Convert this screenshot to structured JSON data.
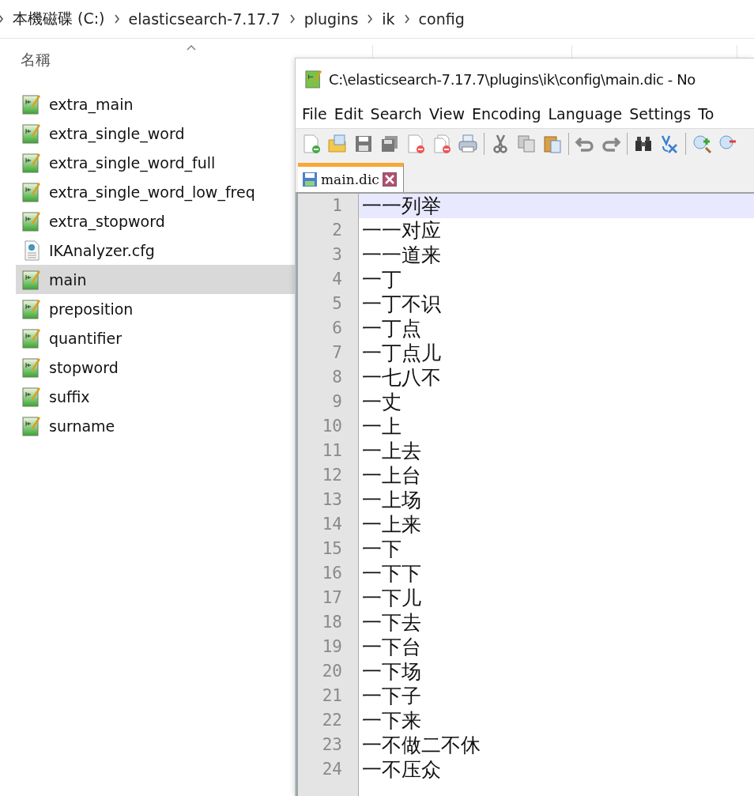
{
  "breadcrumb": [
    "本機磁碟 (C:)",
    "elasticsearch-7.17.7",
    "plugins",
    "ik",
    "config"
  ],
  "file_list": {
    "column_1": "名稱",
    "files": [
      {
        "name": "extra_main",
        "kind": "dictionary",
        "selected": false
      },
      {
        "name": "extra_single_word",
        "kind": "dictionary",
        "selected": false
      },
      {
        "name": "extra_single_word_full",
        "kind": "dictionary",
        "selected": false
      },
      {
        "name": "extra_single_word_low_freq",
        "kind": "dictionary",
        "selected": false
      },
      {
        "name": "extra_stopword",
        "kind": "dictionary",
        "selected": false
      },
      {
        "name": "IKAnalyzer.cfg",
        "kind": "config",
        "selected": false
      },
      {
        "name": "main",
        "kind": "dictionary",
        "selected": true
      },
      {
        "name": "preposition",
        "kind": "dictionary",
        "selected": false
      },
      {
        "name": "quantifier",
        "kind": "dictionary",
        "selected": false
      },
      {
        "name": "stopword",
        "kind": "dictionary",
        "selected": false
      },
      {
        "name": "suffix",
        "kind": "dictionary",
        "selected": false
      },
      {
        "name": "surname",
        "kind": "dictionary",
        "selected": false
      }
    ]
  },
  "editor": {
    "title": "C:\\elasticsearch-7.17.7\\plugins\\ik\\config\\main.dic - No",
    "menu": [
      "File",
      "Edit",
      "Search",
      "View",
      "Encoding",
      "Language",
      "Settings",
      "To"
    ],
    "tabs": [
      {
        "label": "main.dic",
        "selected": true
      }
    ],
    "lines": [
      {
        "number": "1",
        "text": "一一列举",
        "selected": true
      },
      {
        "number": "2",
        "text": "一一对应",
        "selected": false
      },
      {
        "number": "3",
        "text": "一一道来",
        "selected": false
      },
      {
        "number": "4",
        "text": "一丁",
        "selected": false
      },
      {
        "number": "5",
        "text": "一丁不识",
        "selected": false
      },
      {
        "number": "6",
        "text": "一丁点",
        "selected": false
      },
      {
        "number": "7",
        "text": "一丁点儿",
        "selected": false
      },
      {
        "number": "8",
        "text": "一七八不",
        "selected": false
      },
      {
        "number": "9",
        "text": "一丈",
        "selected": false
      },
      {
        "number": "10",
        "text": "一上",
        "selected": false
      },
      {
        "number": "11",
        "text": "一上去",
        "selected": false
      },
      {
        "number": "12",
        "text": "一上台",
        "selected": false
      },
      {
        "number": "13",
        "text": "一上场",
        "selected": false
      },
      {
        "number": "14",
        "text": "一上来",
        "selected": false
      },
      {
        "number": "15",
        "text": "一下",
        "selected": false
      },
      {
        "number": "16",
        "text": "一下下",
        "selected": false
      },
      {
        "number": "17",
        "text": "一下儿",
        "selected": false
      },
      {
        "number": "18",
        "text": "一下去",
        "selected": false
      },
      {
        "number": "19",
        "text": "一下台",
        "selected": false
      },
      {
        "number": "20",
        "text": "一下场",
        "selected": false
      },
      {
        "number": "21",
        "text": "一下子",
        "selected": false
      },
      {
        "number": "22",
        "text": "一下来",
        "selected": false
      },
      {
        "number": "23",
        "text": "一不做二不休",
        "selected": false
      },
      {
        "number": "24",
        "text": "一不压众",
        "selected": false
      }
    ]
  }
}
